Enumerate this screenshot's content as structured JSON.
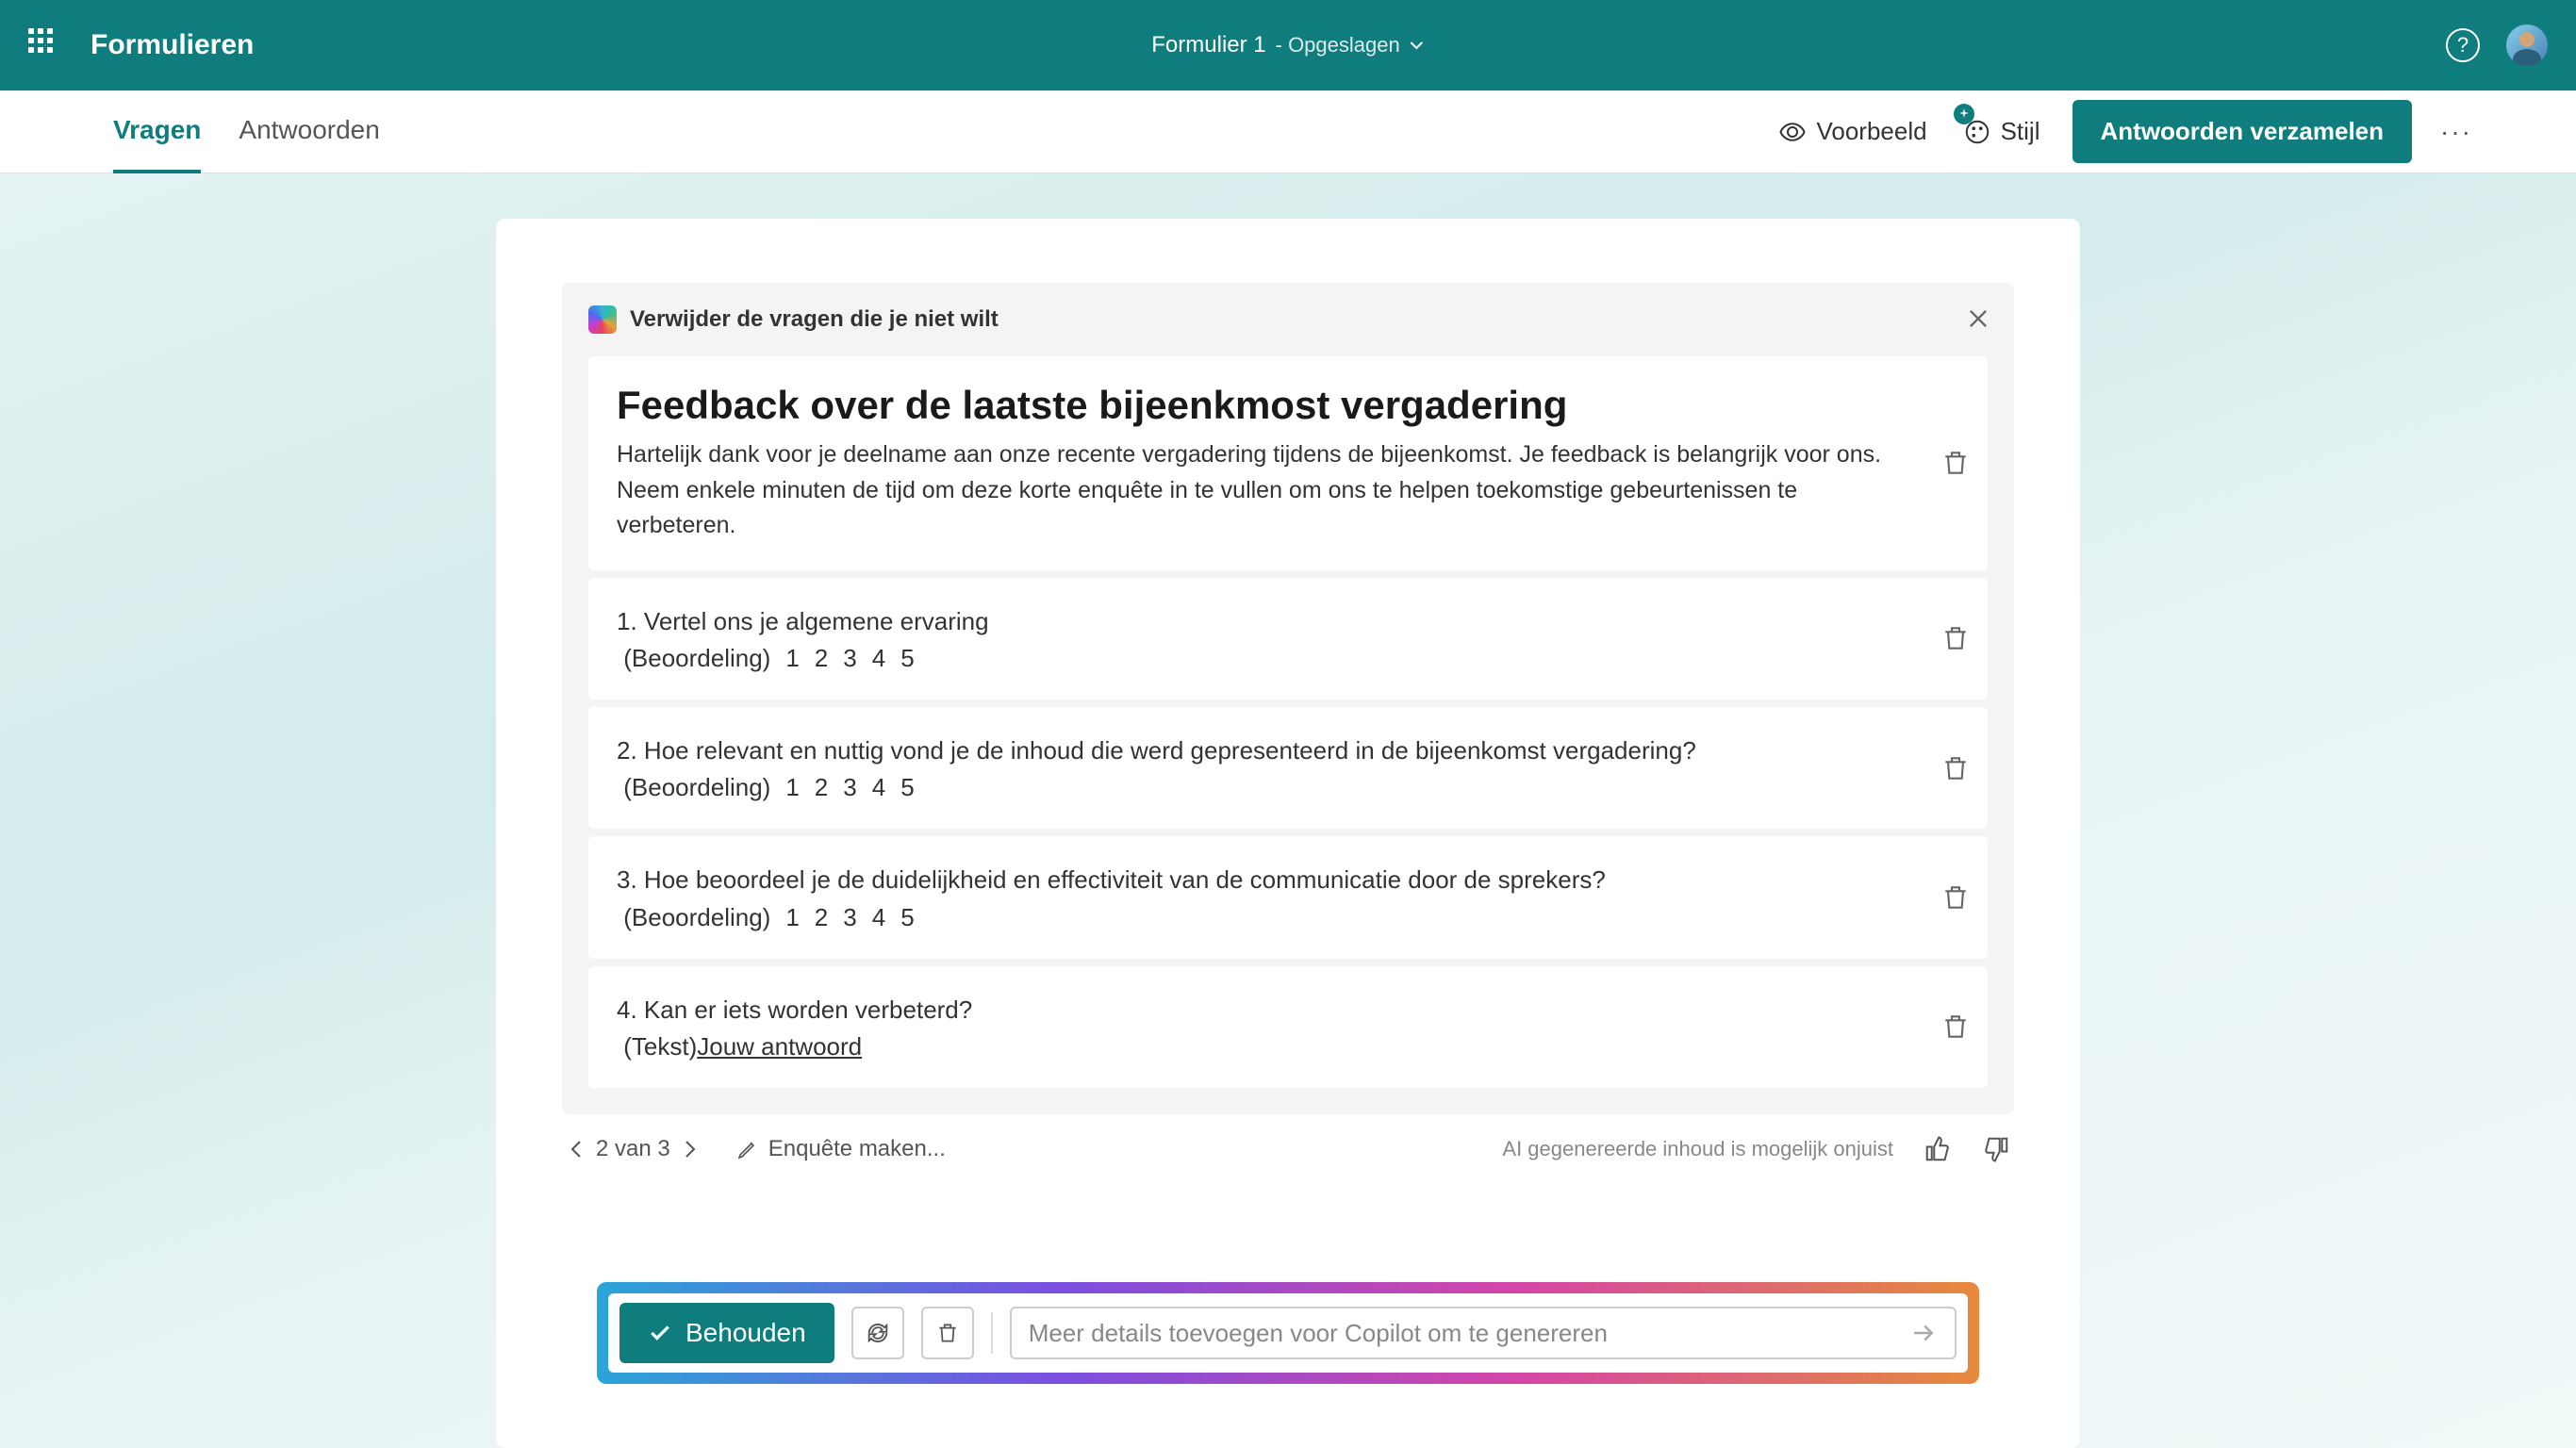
{
  "header": {
    "app_name": "Formulieren",
    "doc_title": "Formulier 1",
    "doc_status": "- Opgeslagen"
  },
  "subbar": {
    "tabs": {
      "questions": "Vragen",
      "answers": "Antwoorden"
    },
    "preview": "Voorbeeld",
    "style": "Stijl",
    "collect": "Antwoorden verzamelen"
  },
  "copilot": {
    "hint": "Verwijder de vragen die je niet wilt",
    "form_title": "Feedback over de laatste bijeenkmost vergadering",
    "form_desc": "Hartelijk dank voor je deelname aan onze recente vergadering tijdens de bijeenkomst. Je feedback is belangrijk voor ons. Neem enkele minuten de tijd om deze korte enquête in te vullen om ons te helpen toekomstige gebeurtenissen te verbeteren."
  },
  "questions": [
    {
      "num": "1.",
      "text": "Vertel ons je algemene ervaring",
      "type_label": "(Beoordeling)",
      "scale": [
        "1",
        "2",
        "3",
        "4",
        "5"
      ]
    },
    {
      "num": "2.",
      "text": "Hoe relevant en nuttig vond je de inhoud die werd gepresenteerd in de bijeenkomst vergadering?",
      "type_label": "(Beoordeling)",
      "scale": [
        "1",
        "2",
        "3",
        "4",
        "5"
      ]
    },
    {
      "num": "3.",
      "text": "Hoe beoordeel je de duidelijkheid en effectiviteit van de communicatie door de sprekers?",
      "type_label": "(Beoordeling)",
      "scale": [
        "1",
        "2",
        "3",
        "4",
        "5"
      ]
    },
    {
      "num": "4.",
      "text": "Kan er iets worden verbeterd?",
      "type_label": "(Tekst)",
      "answer_placeholder": "Jouw antwoord"
    }
  ],
  "pager": {
    "label": "2 van 3",
    "edit": "Enquête maken..."
  },
  "ai_note": "AI gegenereerde inhoud is mogelijk onjuist",
  "actions": {
    "keep": "Behouden",
    "input_placeholder": "Meer details toevoegen voor Copilot om te genereren"
  }
}
